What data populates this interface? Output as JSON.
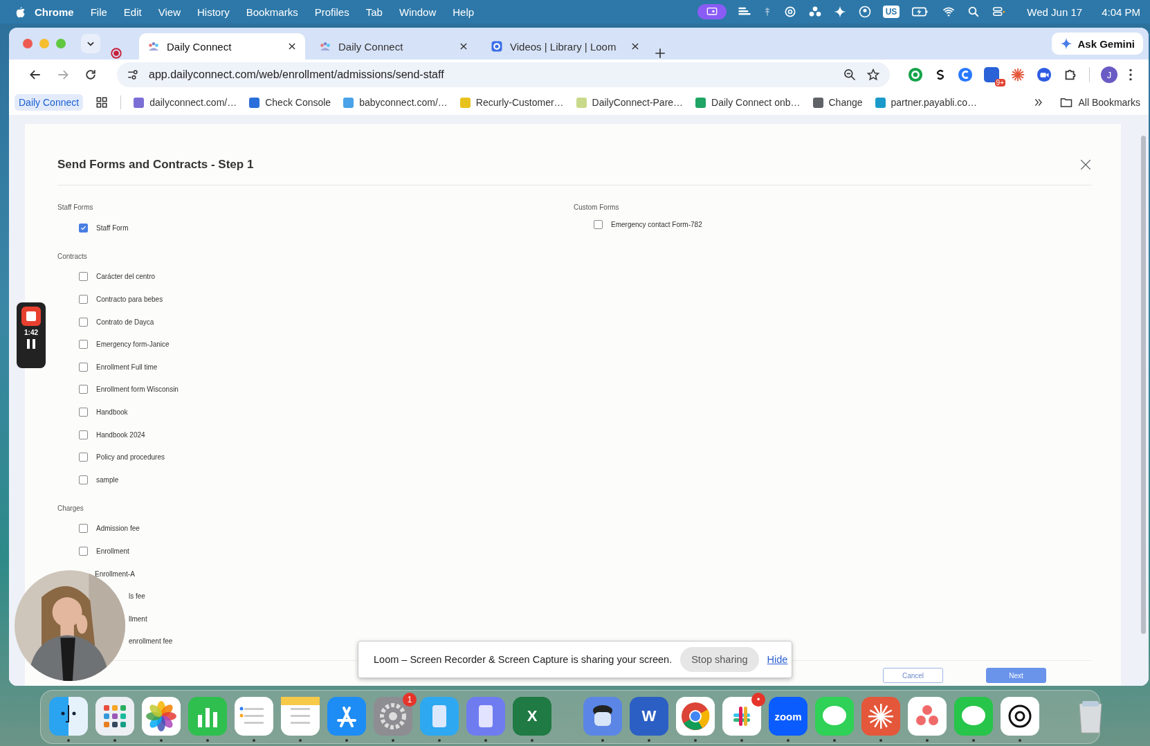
{
  "menu_bar": {
    "app": "Chrome",
    "menus": [
      "File",
      "Edit",
      "View",
      "History",
      "Bookmarks",
      "Profiles",
      "Tab",
      "Window",
      "Help"
    ],
    "keyboard_layout": "US",
    "date": "Wed Jun 17",
    "time": "4:04 PM"
  },
  "browser": {
    "tabs": [
      {
        "title": "Daily Connect",
        "selected": true
      },
      {
        "title": "Daily Connect",
        "selected": false
      },
      {
        "title": "Videos | Library | Loom",
        "selected": false
      }
    ],
    "gemini_button": "Ask Gemini",
    "url": "app.dailyconnect.com/web/enrollment/admissions/send-staff",
    "extension_badge": "9+",
    "profile_initial": "J",
    "bookmarks": [
      {
        "label": "Daily Connect",
        "kind": "chip"
      },
      {
        "label": "dailyconnect.com/…",
        "kind": "link",
        "color": "#7b6fd6"
      },
      {
        "label": "Check Console",
        "kind": "link",
        "color": "#2a6fdb"
      },
      {
        "label": "babyconnect.com/…",
        "kind": "link",
        "color": "#4aa3e8"
      },
      {
        "label": "Recurly-Customer…",
        "kind": "link",
        "color": "#e8c21c"
      },
      {
        "label": "DailyConnect-Pare…",
        "kind": "link",
        "color": "#c9d98a"
      },
      {
        "label": "Daily Connect onb…",
        "kind": "link",
        "color": "#1fa463"
      },
      {
        "label": "Change",
        "kind": "link",
        "color": "#5f6368"
      },
      {
        "label": "partner.payabli.co…",
        "kind": "link",
        "color": "#1b9ac9"
      }
    ],
    "all_bookmarks": "All Bookmarks"
  },
  "modal": {
    "title": "Send Forms and Contracts - Step 1",
    "columns": [
      {
        "sections": [
          {
            "title": "Staff Forms",
            "items": [
              {
                "kind": "checkbox",
                "label": "Staff Form",
                "checked": true
              }
            ]
          },
          {
            "title": "Contracts",
            "items": [
              {
                "kind": "checkbox",
                "label": "Carácter del centro",
                "checked": false
              },
              {
                "kind": "checkbox",
                "label": "Contracto para bebes",
                "checked": false
              },
              {
                "kind": "checkbox",
                "label": "Contrato de Dayca",
                "checked": false
              },
              {
                "kind": "checkbox",
                "label": "Emergency form-Janice",
                "checked": false
              },
              {
                "kind": "checkbox",
                "label": "Enrollment Full time",
                "checked": false
              },
              {
                "kind": "checkbox",
                "label": "Enrollment form Wisconsin",
                "checked": false
              },
              {
                "kind": "checkbox",
                "label": "Handbook",
                "checked": false
              },
              {
                "kind": "checkbox",
                "label": "Handbook 2024",
                "checked": false
              },
              {
                "kind": "checkbox",
                "label": "Policy and procedures",
                "checked": false
              },
              {
                "kind": "checkbox",
                "label": "sample",
                "checked": false
              }
            ]
          },
          {
            "title": "Charges",
            "items": [
              {
                "kind": "checkbox",
                "label": "Admission fee",
                "checked": false
              },
              {
                "kind": "checkbox",
                "label": "Enrollment",
                "checked": false
              },
              {
                "kind": "covered",
                "label": "Enrollment-A"
              },
              {
                "kind": "partial",
                "label": "ls fee"
              },
              {
                "kind": "partial",
                "label": "llment"
              },
              {
                "kind": "partial",
                "label": "enrollment fee"
              }
            ]
          }
        ]
      },
      {
        "sections": [
          {
            "title": "Custom Forms",
            "items": [
              {
                "kind": "checkbox",
                "label": "Emergency contact Form-782",
                "checked": false
              }
            ]
          }
        ]
      }
    ],
    "buttons": [
      {
        "label": "Cancel",
        "kind": "secondary"
      },
      {
        "label": "Next",
        "kind": "primary"
      }
    ]
  },
  "recorder": {
    "elapsed": "1:42"
  },
  "share_bar": {
    "message": "Loom – Screen Recorder & Screen Capture is sharing your screen.",
    "stop_button": "Stop sharing",
    "hide_link": "Hide"
  },
  "dock": [
    {
      "kind": "finder"
    },
    {
      "kind": "launchpad"
    },
    {
      "kind": "photos"
    },
    {
      "kind": "numbers"
    },
    {
      "kind": "reminders"
    },
    {
      "kind": "notes"
    },
    {
      "kind": "appstore"
    },
    {
      "kind": "settings",
      "badge": "1"
    },
    {
      "kind": "screens"
    },
    {
      "kind": "phone"
    },
    {
      "kind": "excel",
      "label": "X"
    },
    {
      "kind": "separator"
    },
    {
      "kind": "scope"
    },
    {
      "kind": "word",
      "label": "W"
    },
    {
      "kind": "chrome"
    },
    {
      "kind": "slack",
      "badge": "•"
    },
    {
      "kind": "zoom",
      "label": "zoom"
    },
    {
      "kind": "messages"
    },
    {
      "kind": "burst"
    },
    {
      "kind": "asana"
    },
    {
      "kind": "whatsapp"
    },
    {
      "kind": "knot"
    },
    {
      "kind": "separator"
    },
    {
      "kind": "trash"
    }
  ]
}
